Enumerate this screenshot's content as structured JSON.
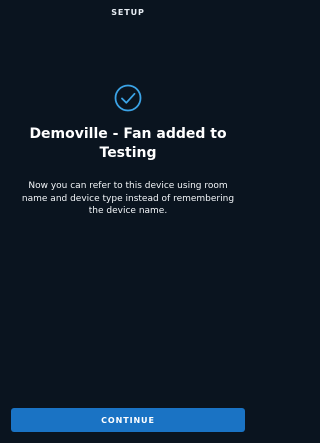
{
  "header": {
    "title": "SETUP"
  },
  "main": {
    "icon": "checkmark-circle-icon",
    "title": "Demoville - Fan added to Testing",
    "message": "Now you can refer to this device using room name and device type instead of remembering the device name."
  },
  "footer": {
    "continue_label": "CONTINUE"
  },
  "colors": {
    "background": "#0a141f",
    "accent": "#1a73c4",
    "icon": "#3ba3e6",
    "text": "#ffffff"
  }
}
